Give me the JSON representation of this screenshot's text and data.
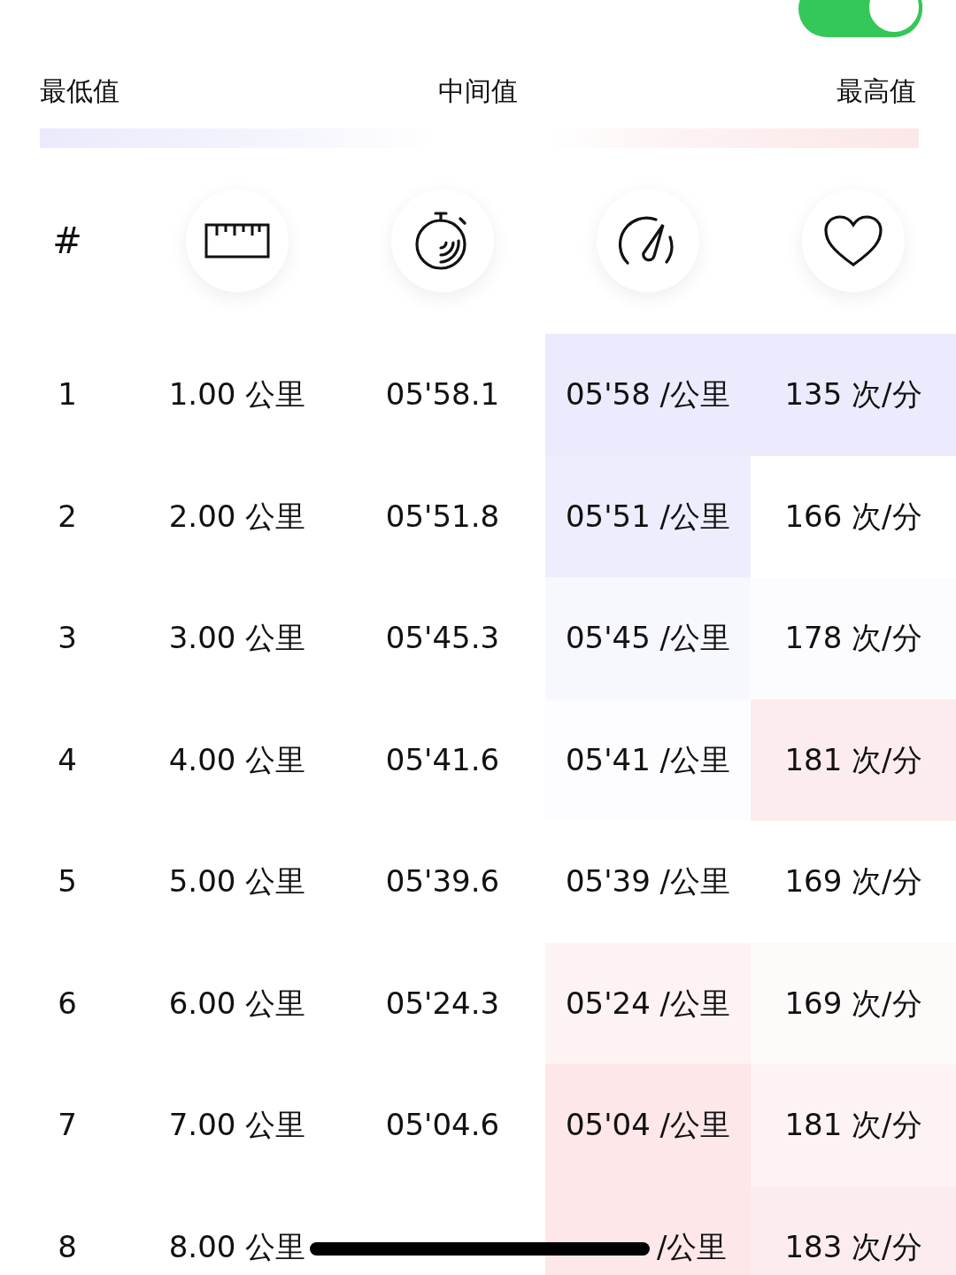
{
  "highlight": {
    "on": true
  },
  "legend": {
    "low": "最低值",
    "mid": "中间值",
    "high": "最高值"
  },
  "table": {
    "columns": [
      {
        "kind": "hash",
        "label": "#"
      },
      {
        "kind": "distance"
      },
      {
        "kind": "time"
      },
      {
        "kind": "pace"
      },
      {
        "kind": "heart"
      }
    ],
    "rows": [
      {
        "index": "1",
        "distance": "1.00 公里",
        "time": "05'58.1",
        "pace": {
          "text": "05'58 /公里",
          "color": "#ebebfd"
        },
        "heart": {
          "text": "135 次/分",
          "color": "#ebebfd"
        }
      },
      {
        "index": "2",
        "distance": "2.00 公里",
        "time": "05'51.8",
        "pace": {
          "text": "05'51 /公里",
          "color": "#ededfd"
        },
        "heart": {
          "text": "166 次/分",
          "color": "#ffffff"
        }
      },
      {
        "index": "3",
        "distance": "3.00 公里",
        "time": "05'45.3",
        "pace": {
          "text": "05'45 /公里",
          "color": "#f7f7fe"
        },
        "heart": {
          "text": "178 次/分",
          "color": "#fcfcff"
        }
      },
      {
        "index": "4",
        "distance": "4.00 公里",
        "time": "05'41.6",
        "pace": {
          "text": "05'41 /公里",
          "color": "#fdfdff"
        },
        "heart": {
          "text": "181 次/分",
          "color": "#fdeced"
        }
      },
      {
        "index": "5",
        "distance": "5.00 公里",
        "time": "05'39.6",
        "pace": {
          "text": "05'39 /公里",
          "color": "#ffffff"
        },
        "heart": {
          "text": "169 次/分",
          "color": "#ffffff"
        }
      },
      {
        "index": "6",
        "distance": "6.00 公里",
        "time": "05'24.3",
        "pace": {
          "text": "05'24 /公里",
          "color": "#fdf3f3"
        },
        "heart": {
          "text": "169 次/分",
          "color": "#fefafa"
        }
      },
      {
        "index": "7",
        "distance": "7.00 公里",
        "time": "05'04.6",
        "pace": {
          "text": "05'04 /公里",
          "color": "#fde7e8"
        },
        "heart": {
          "text": "181 次/分",
          "color": "#fdf3f3"
        }
      },
      {
        "index": "8",
        "distance": "8.00 公里",
        "pace": {
          "text": "/公里",
          "color": "#fde7e8"
        },
        "heart": {
          "text": "183 次/分",
          "color": "#fdeced"
        }
      }
    ]
  }
}
